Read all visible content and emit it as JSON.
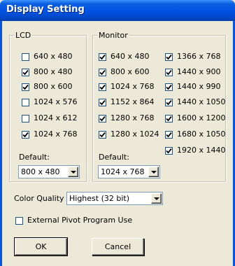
{
  "window": {
    "title": "Display Setting"
  },
  "lcd": {
    "legend": "LCD",
    "items": [
      {
        "label": "640 x 480",
        "checked": false
      },
      {
        "label": "800 x 480",
        "checked": true
      },
      {
        "label": "800 x 600",
        "checked": true
      },
      {
        "label": "1024 x 576",
        "checked": false
      },
      {
        "label": "1024 x 612",
        "checked": false
      },
      {
        "label": "1024 x 768",
        "checked": true
      }
    ],
    "default_label": "Default:",
    "default_value": "800 x 480"
  },
  "monitor": {
    "legend": "Monitor",
    "col1": [
      {
        "label": "640 x 480",
        "checked": true
      },
      {
        "label": "800 x 600",
        "checked": true
      },
      {
        "label": "1024 x 768",
        "checked": true
      },
      {
        "label": "1152 x 864",
        "checked": true
      },
      {
        "label": "1280 x 768",
        "checked": true
      },
      {
        "label": "1280 x 1024",
        "checked": true
      }
    ],
    "col2": [
      {
        "label": "1366 x 768",
        "checked": true
      },
      {
        "label": "1440 x 900",
        "checked": true
      },
      {
        "label": "1440 x 990",
        "checked": true
      },
      {
        "label": "1440 x 1050",
        "checked": true
      },
      {
        "label": "1600 x 1200",
        "checked": true
      },
      {
        "label": "1680 x 1050",
        "checked": true
      },
      {
        "label": "1920 x 1440",
        "checked": true
      }
    ],
    "default_label": "Default:",
    "default_value": "1024 x 768"
  },
  "color_quality": {
    "label": "Color Quality :",
    "value": "Highest (32 bit)"
  },
  "pivot": {
    "label": "External Pivot Program Use",
    "checked": false
  },
  "buttons": {
    "ok": "OK",
    "cancel": "Cancel"
  },
  "colors": {
    "title_bar": "#0054e3",
    "dialog_bg": "#ece9d8"
  }
}
